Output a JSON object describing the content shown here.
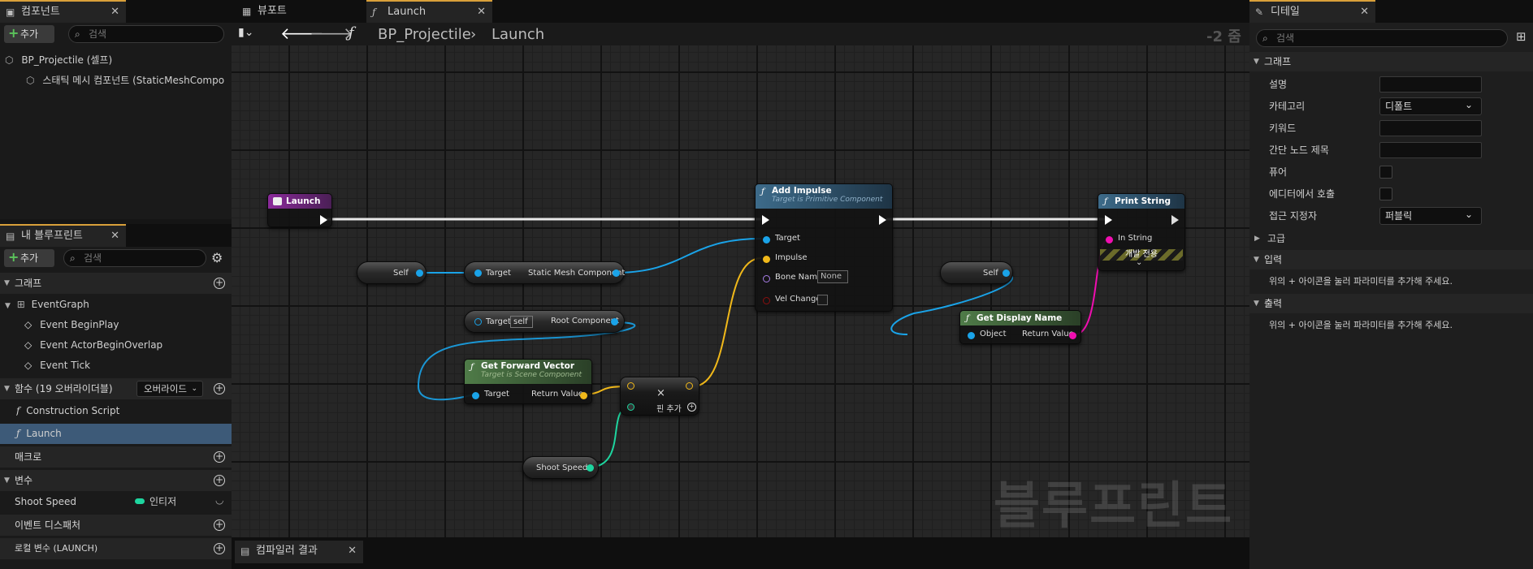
{
  "components": {
    "tab_label": "컴포넌트",
    "add_label": "추가",
    "search_placeholder": "검색",
    "items": [
      "BP_Projectile (셀프)",
      "스태틱 메시 컴포넌트 (StaticMeshCompo"
    ]
  },
  "my_blueprint": {
    "tab_label": "내 블루프린트",
    "add_label": "추가",
    "search_placeholder": "검색",
    "graph_section": "그래프",
    "event_graph": "EventGraph",
    "events": [
      "Event BeginPlay",
      "Event ActorBeginOverlap",
      "Event Tick"
    ],
    "functions_section": "함수 (19 오버라이더블)",
    "override_label": "오버라이드",
    "functions": [
      "Construction Script",
      "Launch"
    ],
    "macros_section": "매크로",
    "variables_section": "변수",
    "variable_name": "Shoot Speed",
    "variable_type": "인티저",
    "dispatchers_section": "이벤트 디스패처",
    "local_vars_section": "로컬 변수 (LAUNCH)"
  },
  "editor": {
    "tabs": [
      "뷰포트",
      "Launch"
    ],
    "breadcrumb_root": "BP_Projectile",
    "breadcrumb_current": "Launch",
    "zoom": "-2 줌",
    "watermark": "블루프린트",
    "compiler_tab": "컴파일러 결과"
  },
  "nodes": {
    "launch": {
      "title": "Launch"
    },
    "add_impulse": {
      "title": "Add Impulse",
      "subtitle": "Target is Primitive Component",
      "pins": [
        "Target",
        "Impulse",
        "Bone Name",
        "Vel Change"
      ],
      "bone_value": "None"
    },
    "print_string": {
      "title": "Print String",
      "pin": "In String",
      "dev_only": "개발 전용"
    },
    "self1": "Self",
    "self2": "Self",
    "static_mesh_getter": {
      "target": "Target",
      "output": "Static Mesh Component"
    },
    "root_component": {
      "target": "Target",
      "self_value": "self",
      "output": "Root Component"
    },
    "forward_vector": {
      "title": "Get Forward Vector",
      "subtitle": "Target is Scene Component",
      "target": "Target",
      "output": "Return Value"
    },
    "multiply": {
      "add_pin": "핀 추가"
    },
    "shoot_speed": "Shoot Speed",
    "display_name": {
      "title": "Get Display Name",
      "input": "Object",
      "output": "Return Value"
    }
  },
  "details": {
    "tab_label": "디테일",
    "search_placeholder": "검색",
    "graph_section": "그래프",
    "rows": [
      "설명",
      "카테고리",
      "키워드",
      "간단 노드 제목",
      "퓨어",
      "에디터에서 호출",
      "접근 지정자"
    ],
    "category_value": "디폴트",
    "access_value": "퍼블릭",
    "advanced_section": "고급",
    "inputs_section": "입력",
    "inputs_hint": "위의 + 아이콘을 눌러 파라미터를 추가해 주세요.",
    "outputs_section": "출력",
    "outputs_hint": "위의 + 아이콘을 눌러 파라미터를 추가해 주세요."
  },
  "colors": {
    "exec": "#ffffff",
    "object_pin": "#1aa3e8",
    "vector_pin": "#f0b81a",
    "name_pin": "#a87ee8",
    "bool_pin": "#8b0f0f",
    "string_pin": "#f00eb0",
    "int_pin": "#1ed59f",
    "function_header": "#3d6b8a",
    "pure_header": "#4f7b48",
    "event_header": "#7a2a8a"
  }
}
